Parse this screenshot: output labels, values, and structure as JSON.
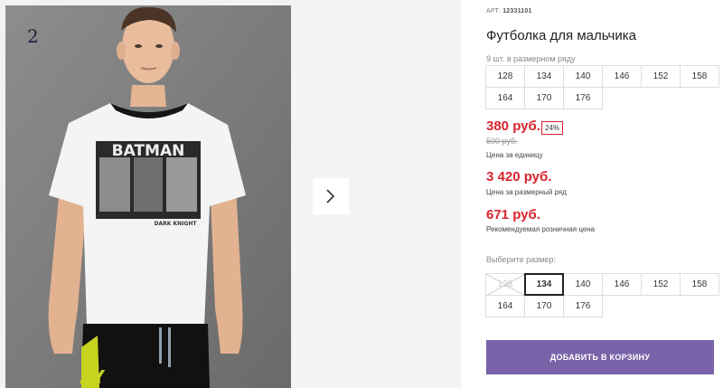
{
  "gallery": {
    "photo_index": "2",
    "print_text": "BATMAN",
    "print_subtext": "DARK KNIGHT",
    "shorts_text": "AY"
  },
  "product": {
    "art_label": "АРТ:",
    "art_number": "12331101",
    "title": "Футболка для мальчика",
    "size_count_text": "9 шт. в размерном ряду"
  },
  "size_row": [
    "128",
    "134",
    "140",
    "146",
    "152",
    "158",
    "164",
    "170",
    "176"
  ],
  "prices": {
    "unit_price": "380 руб.",
    "discount": "24%",
    "old_price": "500 руб.",
    "unit_caption": "Цена за единицу",
    "row_price": "3 420 руб.",
    "row_caption": "Цена за размерный ряд",
    "retail_price": "671 руб.",
    "retail_caption": "Рекомендуемая розничная цена"
  },
  "size_select": {
    "label": "Выберите размер:",
    "options": [
      "128",
      "134",
      "140",
      "146",
      "152",
      "158",
      "164",
      "170",
      "176"
    ],
    "selected": "134",
    "unavailable": [
      "128"
    ]
  },
  "cart": {
    "button_label": "ДОБАВИТЬ В КОРЗИНУ",
    "accent_color": "#7a63a8"
  },
  "colors": {
    "price_red": "#d9232d"
  }
}
